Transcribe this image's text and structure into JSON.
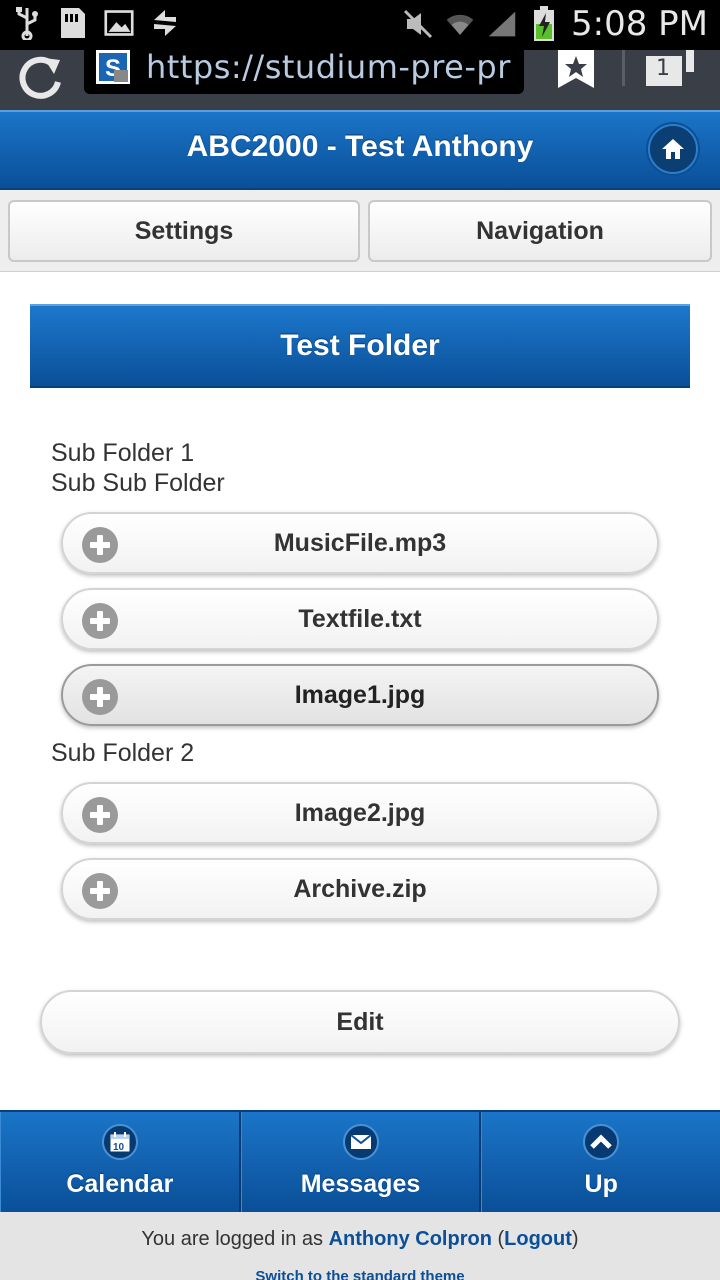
{
  "status_bar": {
    "time": "5:08 PM",
    "icons": [
      "usb-icon",
      "sd-card-icon",
      "image-icon",
      "sync-icon",
      "mute-icon",
      "wifi-icon",
      "signal-icon",
      "battery-charging-icon"
    ]
  },
  "browser": {
    "url": "https://studium-pre-pr",
    "tab_count": "1"
  },
  "header": {
    "title": "ABC2000 - Test Anthony"
  },
  "subnav": {
    "settings_label": "Settings",
    "navigation_label": "Navigation"
  },
  "folder": {
    "title": "Test Folder",
    "sub_folder_1": "Sub Folder 1",
    "sub_sub_folder": "Sub Sub Folder",
    "sub_folder_2": "Sub Folder 2",
    "files_group1": [
      {
        "name": "MusicFile.mp3"
      },
      {
        "name": "Textfile.txt"
      },
      {
        "name": "Image1.jpg"
      }
    ],
    "files_group2": [
      {
        "name": "Image2.jpg"
      },
      {
        "name": "Archive.zip"
      }
    ],
    "edit_label": "Edit"
  },
  "footer_nav": {
    "items": [
      {
        "label": "Calendar",
        "icon": "calendar-icon",
        "day": "10"
      },
      {
        "label": "Messages",
        "icon": "envelope-icon"
      },
      {
        "label": "Up",
        "icon": "chevron-up-icon"
      }
    ]
  },
  "login": {
    "prefix": "You are logged in as ",
    "user": "Anthony Colpron",
    "open_paren": " (",
    "logout": "Logout",
    "close_paren": ")",
    "switch_theme": "Switch to the standard theme"
  },
  "colors": {
    "header_blue": "#0a4f98",
    "header_blue_light": "#1b75c8",
    "link_blue": "#0a4f98"
  }
}
